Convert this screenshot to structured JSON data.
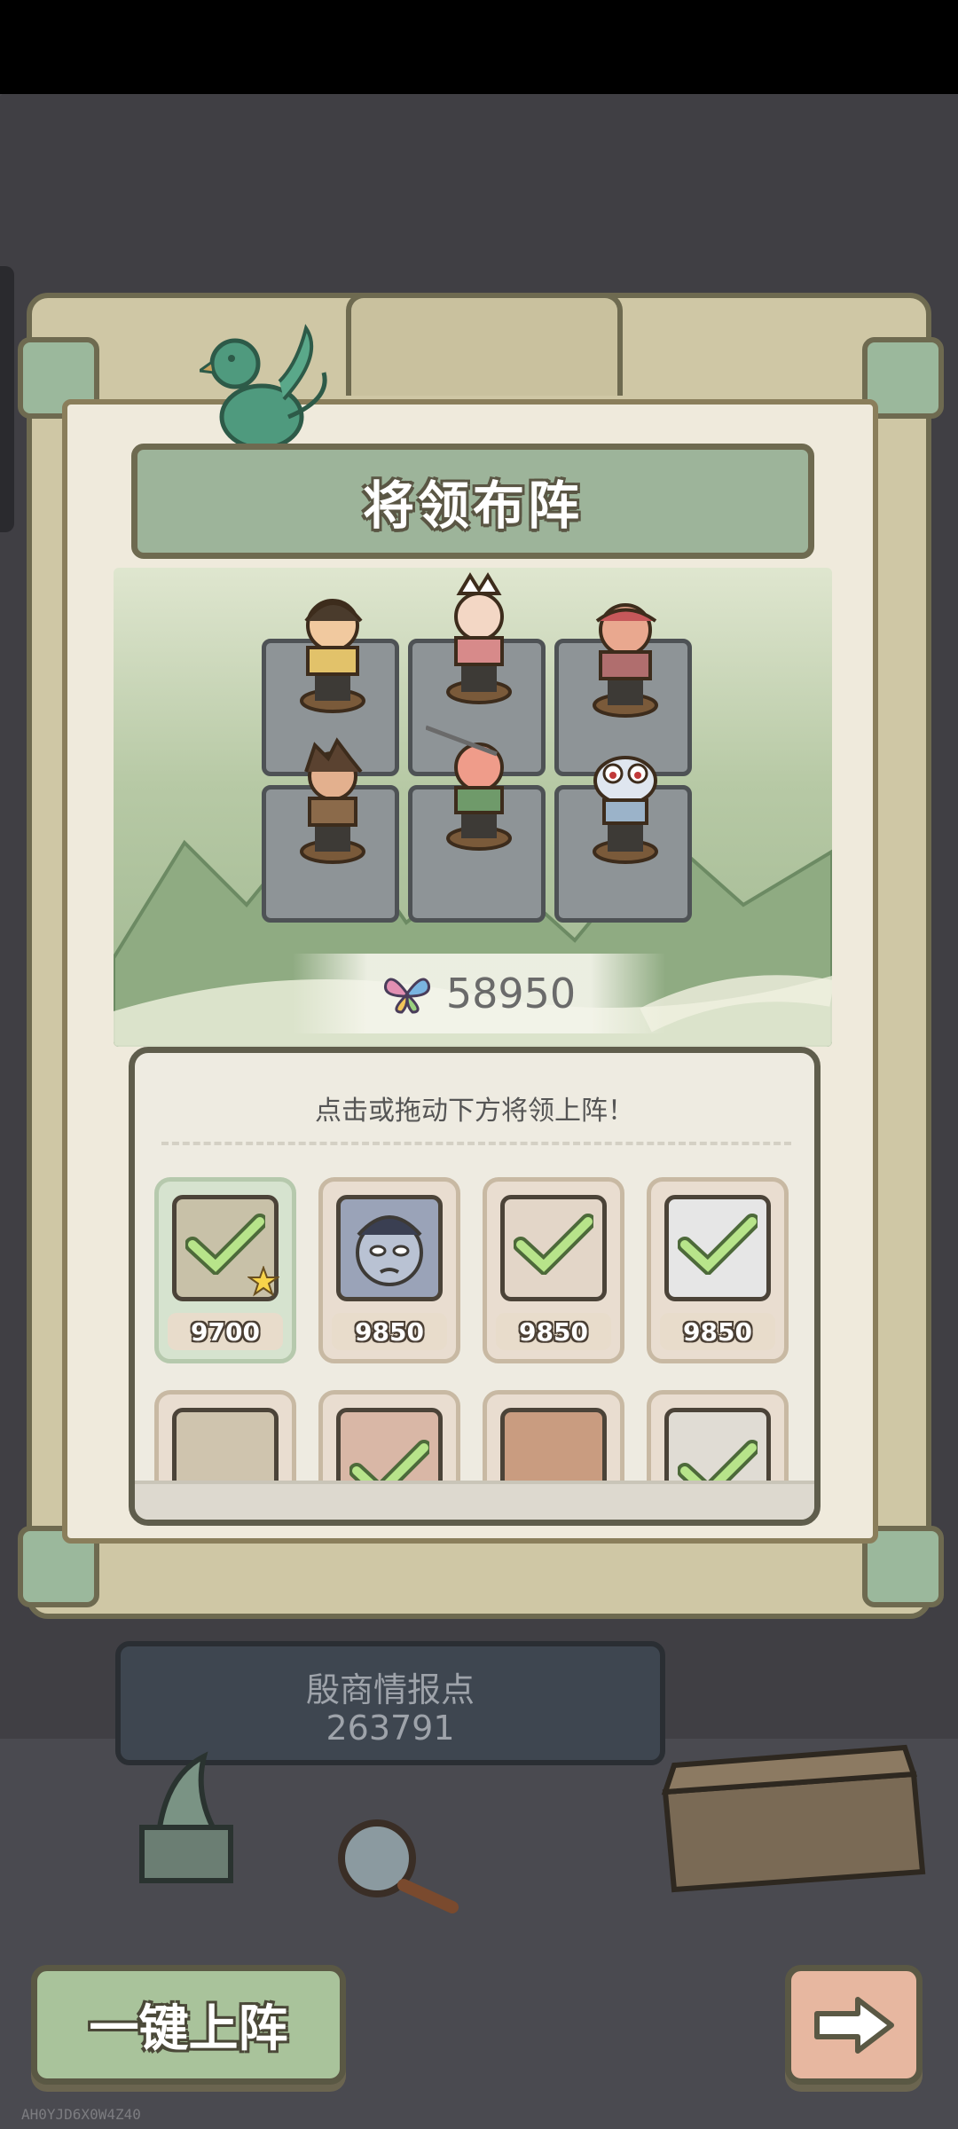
{
  "title": "将领布阵",
  "team_power": "58950",
  "panel_hint": "点击或拖动下方将领上阵！",
  "cards": [
    {
      "score": "9700",
      "selected": true
    },
    {
      "score": "9850",
      "selected": false
    },
    {
      "score": "9850",
      "selected": true
    },
    {
      "score": "9850",
      "selected": true
    }
  ],
  "intel": {
    "label": "殷商情报点",
    "value": "263791"
  },
  "buttons": {
    "one_key": "一键上阵"
  },
  "watermark": "AH0YJD6X0W4Z40"
}
